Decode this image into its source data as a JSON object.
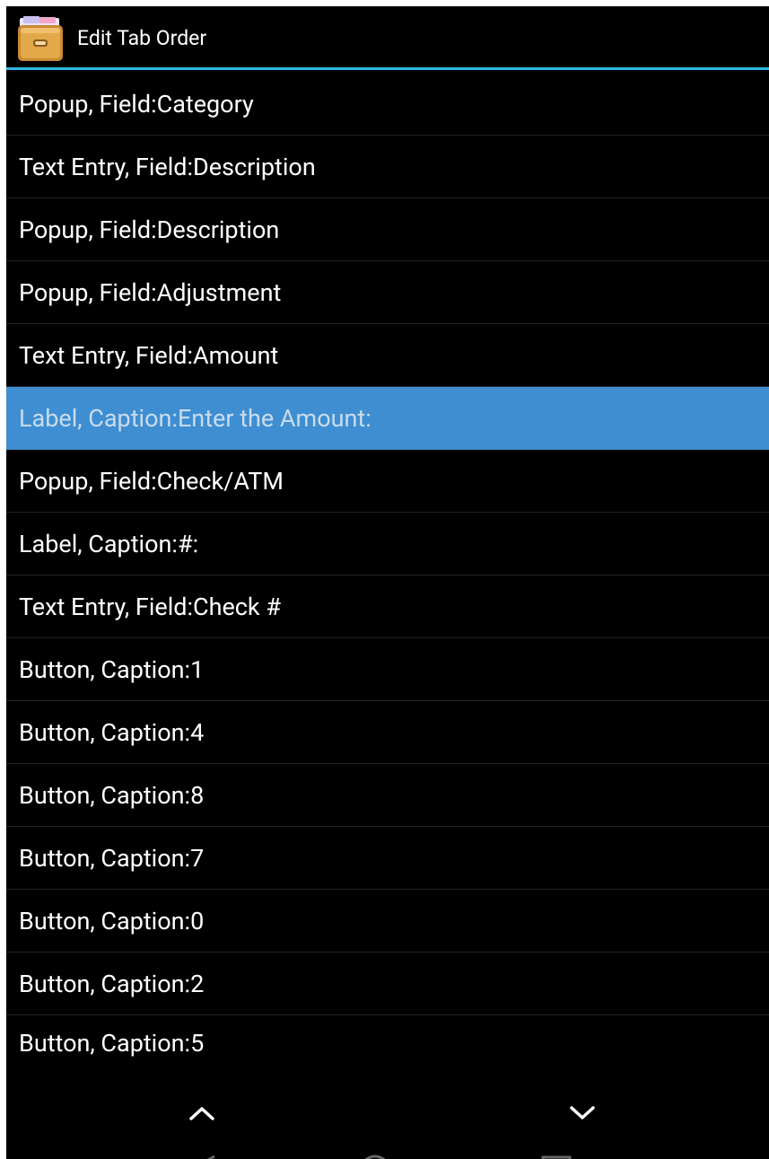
{
  "app": {
    "title": "Edit Tab Order",
    "icon": "file-cabinet-icon"
  },
  "colors": {
    "accent": "#33b5e5",
    "selected_row": "#3f8ed2",
    "background": "#000000"
  },
  "items": [
    {
      "label": "Popup, Field:Category",
      "selected": false
    },
    {
      "label": "Text Entry, Field:Description",
      "selected": false
    },
    {
      "label": "Popup, Field:Description",
      "selected": false
    },
    {
      "label": "Popup, Field:Adjustment",
      "selected": false
    },
    {
      "label": "Text Entry, Field:Amount",
      "selected": false
    },
    {
      "label": "Label, Caption:Enter the Amount:",
      "selected": true
    },
    {
      "label": "Popup, Field:Check/ATM",
      "selected": false
    },
    {
      "label": "Label, Caption:#:",
      "selected": false
    },
    {
      "label": "Text Entry, Field:Check #",
      "selected": false
    },
    {
      "label": "Button, Caption:1",
      "selected": false
    },
    {
      "label": "Button, Caption:4",
      "selected": false
    },
    {
      "label": "Button, Caption:8",
      "selected": false
    },
    {
      "label": "Button, Caption:7",
      "selected": false
    },
    {
      "label": "Button, Caption:0",
      "selected": false
    },
    {
      "label": "Button, Caption:2",
      "selected": false
    },
    {
      "label": "Button, Caption:5",
      "selected": false
    }
  ],
  "controls": {
    "move_up_icon": "chevron-up-icon",
    "move_down_icon": "chevron-down-icon"
  }
}
